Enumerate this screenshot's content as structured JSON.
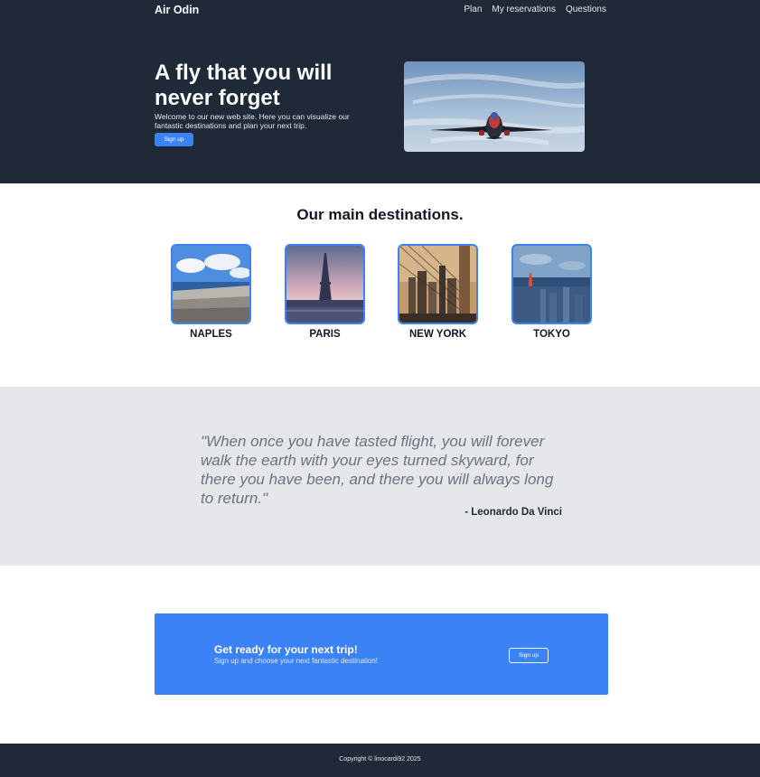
{
  "header": {
    "brand": "Air Odin",
    "nav": [
      "Plan",
      "My reservations",
      "Questions"
    ]
  },
  "hero": {
    "title": "A fly that you will never forget",
    "text": "Welcome to our new web site. Here you can visualize our fantastic destinations and plan your next trip.",
    "signup_label": "Sign up",
    "image": "airplane-in-sky"
  },
  "destinations": {
    "title": "Our main destinations.",
    "items": [
      {
        "name": "NAPLES",
        "image": "naples-bay"
      },
      {
        "name": "PARIS",
        "image": "eiffel-tower-dusk"
      },
      {
        "name": "NEW YORK",
        "image": "brooklyn-bridge-skyline"
      },
      {
        "name": "TOKYO",
        "image": "tokyo-tower-city"
      }
    ]
  },
  "quote": {
    "text": "\"When once you have tasted flight, you will forever walk the earth with your eyes turned skyward, for there you have been, and there you will always long to return.\"",
    "author": "- Leonardo Da Vinci"
  },
  "cta": {
    "title": "Get ready for your next trip!",
    "text": "Sign up and choose your next fantastic destination!",
    "signup_label": "Sign up"
  },
  "footer": {
    "copyright": "Copyright © linocardi92 2025"
  },
  "colors": {
    "dark": "#1f2937",
    "accent": "#3b82f6",
    "quote_bg": "#e5e7eb"
  }
}
